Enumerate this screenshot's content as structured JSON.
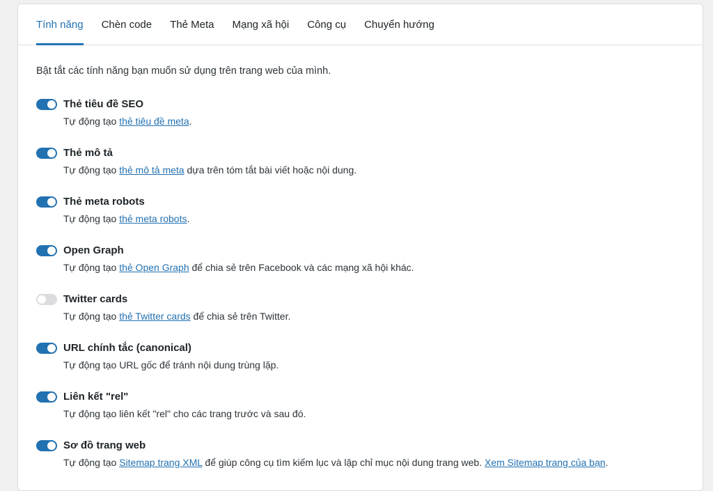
{
  "tabs": [
    "Tính năng",
    "Chèn code",
    "Thẻ Meta",
    "Mạng xã hội",
    "Công cụ",
    "Chuyển hướng"
  ],
  "intro": "Bật tắt các tính năng bạn muốn sử dụng trên trang web của mình.",
  "features": [
    {
      "title": "Thẻ tiêu đề SEO",
      "enabled": true,
      "desc_pre": "Tự động tạo ",
      "link": "thẻ tiêu đề meta",
      "desc_post": ".",
      "link2": "",
      "desc_post2": ""
    },
    {
      "title": "Thẻ mô tả",
      "enabled": true,
      "desc_pre": "Tự động tạo ",
      "link": "thẻ mô tả meta",
      "desc_post": " dựa trên tóm tắt bài viết hoặc nội dung.",
      "link2": "",
      "desc_post2": ""
    },
    {
      "title": "Thẻ meta robots",
      "enabled": true,
      "desc_pre": "Tự động tạo ",
      "link": "thẻ meta robots",
      "desc_post": ".",
      "link2": "",
      "desc_post2": ""
    },
    {
      "title": "Open Graph",
      "enabled": true,
      "desc_pre": "Tự động tạo ",
      "link": "thẻ Open Graph",
      "desc_post": " để chia sẻ trên Facebook và các mạng xã hội khác.",
      "link2": "",
      "desc_post2": ""
    },
    {
      "title": "Twitter cards",
      "enabled": false,
      "desc_pre": "Tự động tạo ",
      "link": "thẻ Twitter cards",
      "desc_post": " để chia sẻ trên Twitter.",
      "link2": "",
      "desc_post2": ""
    },
    {
      "title": "URL chính tắc (canonical)",
      "enabled": true,
      "desc_pre": "Tự động tạo URL gốc để tránh nội dung trùng lặp.",
      "link": "",
      "desc_post": "",
      "link2": "",
      "desc_post2": ""
    },
    {
      "title": "Liên kết \"rel\"",
      "enabled": true,
      "desc_pre": "Tự động tạo liên kết \"rel\" cho các trang trước và sau đó.",
      "link": "",
      "desc_post": "",
      "link2": "",
      "desc_post2": ""
    },
    {
      "title": "Sơ đồ trang web",
      "enabled": true,
      "desc_pre": "Tự động tạo ",
      "link": "Sitemap trang XML",
      "desc_post": " để giúp công cụ tìm kiếm lục và lập chỉ mục nội dung trang web. ",
      "link2": "Xem Sitemap trang của bạn",
      "desc_post2": "."
    }
  ],
  "colors": {
    "accent": "#2271b1",
    "toggle_off": "#dcdcde"
  }
}
